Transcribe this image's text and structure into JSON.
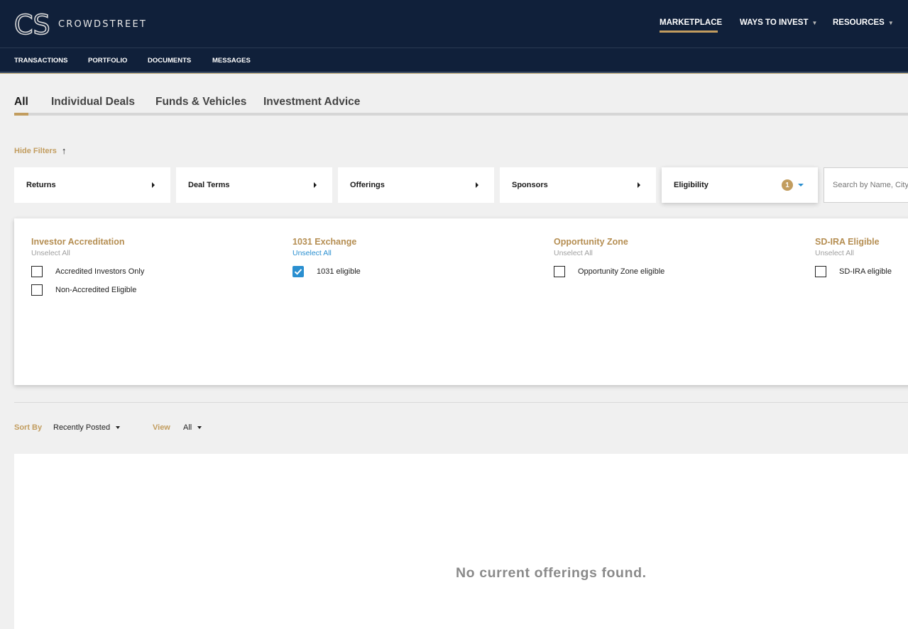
{
  "brand": {
    "name": "CROWDSTREET",
    "mark": "CS"
  },
  "top_nav": {
    "marketplace": "MARKETPLACE",
    "ways_to_invest": "WAYS TO INVEST",
    "resources": "RESOURCES"
  },
  "sub_nav": {
    "transactions": "TRANSACTIONS",
    "portfolio": "PORTFOLIO",
    "documents": "DOCUMENTS",
    "messages": "MESSAGES"
  },
  "tabs": [
    "All",
    "Individual Deals",
    "Funds & Vehicles",
    "Investment Advice"
  ],
  "hide_filters": "Hide Filters",
  "filters": {
    "returns": "Returns",
    "deal_terms": "Deal Terms",
    "offerings": "Offerings",
    "sponsors": "Sponsors",
    "eligibility": "Eligibility",
    "eligibility_count": "1"
  },
  "search": {
    "placeholder": "Search by Name, City, State"
  },
  "eligibility_panel": {
    "columns": [
      {
        "title": "Investor Accreditation",
        "unselect": "Unselect All",
        "options": [
          "Accredited Investors Only",
          "Non-Accredited Eligible"
        ]
      },
      {
        "title": "1031 Exchange",
        "unselect": "Unselect All",
        "options": [
          "1031 eligible"
        ]
      },
      {
        "title": "Opportunity Zone",
        "unselect": "Unselect All",
        "options": [
          "Opportunity Zone eligible"
        ]
      },
      {
        "title": "SD-IRA Eligible",
        "unselect": "Unselect All",
        "options": [
          "SD-IRA eligible"
        ]
      }
    ]
  },
  "sort": {
    "label": "Sort By",
    "value": "Recently Posted"
  },
  "view": {
    "label": "View",
    "value": "All"
  },
  "empty_message": "No current offerings found.",
  "colors": {
    "navy": "#10203a",
    "gold": "#c29d5f",
    "blue": "#2a8fd0"
  },
  "icons": {
    "hide_filters": "arrow-up-icon",
    "checkbox_checked": "check-icon"
  }
}
